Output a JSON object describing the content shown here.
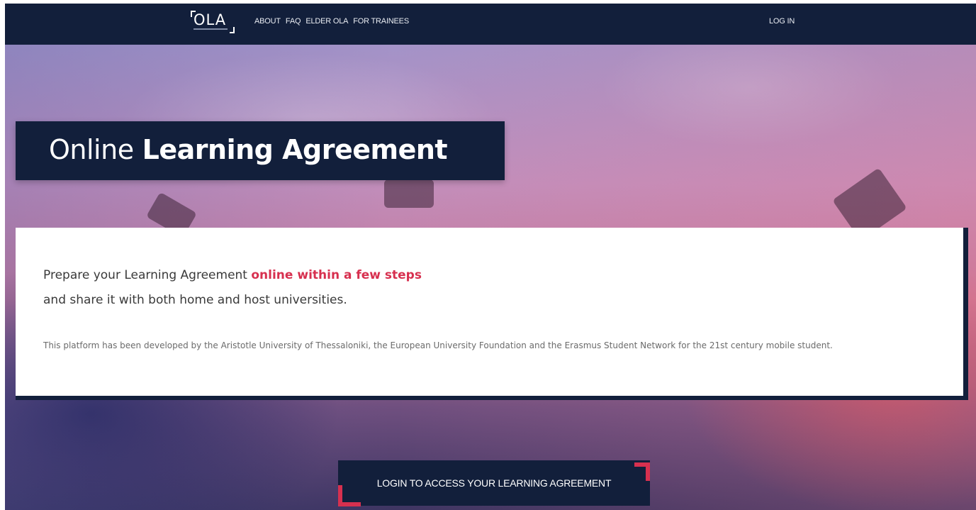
{
  "navbar": {
    "logo_text": "OLA",
    "links": [
      {
        "label": "ABOUT"
      },
      {
        "label": "FAQ"
      },
      {
        "label": "ELDER OLA"
      },
      {
        "label": "FOR TRAINEES"
      }
    ],
    "login_label": "LOG IN"
  },
  "hero": {
    "title_light": "Online",
    "title_bold": "Learning Agreement"
  },
  "intro": {
    "line1_prefix": "Prepare your Learning Agreement ",
    "line1_accent": "online within a few steps",
    "line2": "and share it with both home and host universities.",
    "description": "This platform has been developed by the Aristotle University of Thessaloniki, the European University Foundation and the Erasmus Student Network for the 21st century mobile student."
  },
  "cta": {
    "label": "LOGIN TO ACCESS YOUR LEARNING AGREEMENT"
  },
  "colors": {
    "navy": "#121f3b",
    "accent": "#d7304f"
  }
}
